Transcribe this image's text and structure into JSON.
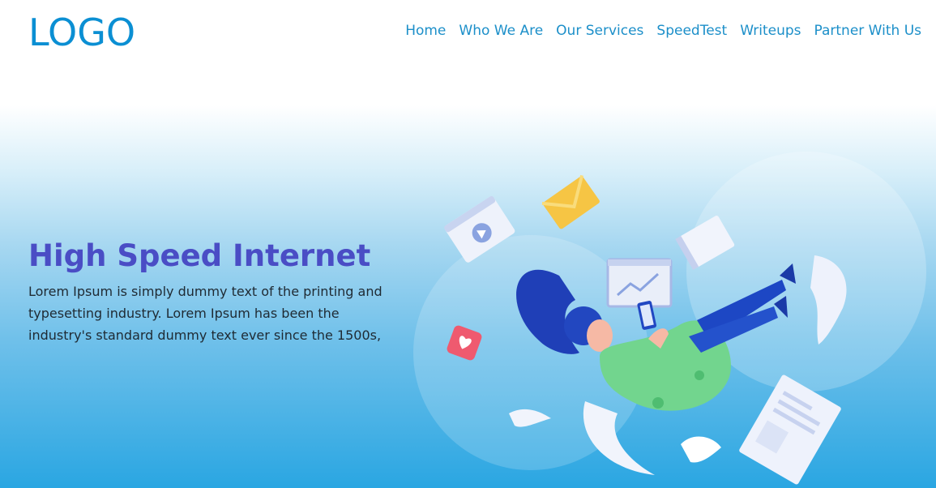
{
  "header": {
    "logo": "LOGO",
    "nav": [
      {
        "label": "Home"
      },
      {
        "label": "Who We Are"
      },
      {
        "label": "Our Services"
      },
      {
        "label": "SpeedTest"
      },
      {
        "label": "Writeups"
      },
      {
        "label": "Partner With Us"
      }
    ]
  },
  "hero": {
    "title": "High Speed Internet",
    "text": "Lorem Ipsum is simply dummy text of the printing and typesetting industry. Lorem Ipsum has been the industry's standard dummy text ever since the 1500s,"
  },
  "colors": {
    "brand": "#0b8fd3",
    "nav_link": "#1c8fc9",
    "title": "#4a4dc5",
    "gradient_bottom": "#2aa6e2"
  },
  "icons": [
    "video-card-icon",
    "envelope-icon",
    "chart-card-icon",
    "folder-icon",
    "heart-notification-icon",
    "phone-icon",
    "document-icon"
  ]
}
